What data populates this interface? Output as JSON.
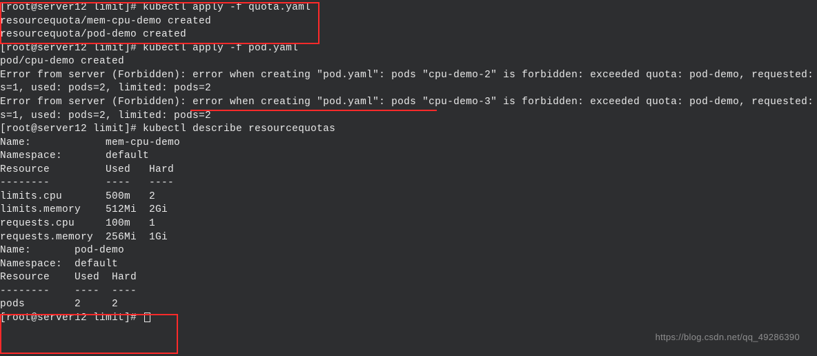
{
  "terminal": {
    "lines": {
      "l1": "[root@server12 limit]# kubectl apply -f quota.yaml",
      "l2": "resourcequota/mem-cpu-demo created",
      "l3": "resourcequota/pod-demo created",
      "l4": "[root@server12 limit]# kubectl apply -f pod.yaml",
      "l5": "pod/cpu-demo created",
      "l6": "Error from server (Forbidden): error when creating \"pod.yaml\": pods \"cpu-demo-2\" is forbidden: exceeded quota: pod-demo, requested:",
      "l7": "s=1, used: pods=2, limited: pods=2",
      "l8": "Error from server (Forbidden): error when creating \"pod.yaml\": pods \"cpu-demo-3\" is forbidden: exceeded quota: pod-demo, requested:",
      "l9": "s=1, used: pods=2, limited: pods=2",
      "l10": "[root@server12 limit]# kubectl describe resourcequotas",
      "l11": "Name:            mem-cpu-demo",
      "l12": "Namespace:       default",
      "l13": "Resource         Used   Hard",
      "l14": "--------         ----   ----",
      "l15": "limits.cpu       500m   2",
      "l16": "limits.memory    512Mi  2Gi",
      "l17": "requests.cpu     100m   1",
      "l18": "requests.memory  256Mi  1Gi",
      "l19": "",
      "l20": "",
      "l21": "Name:       pod-demo",
      "l22": "Namespace:  default",
      "l23": "Resource    Used  Hard",
      "l24": "--------    ----  ----",
      "l25": "pods        2     2",
      "l26": "[root@server12 limit]# "
    }
  },
  "resourcequota1": {
    "name": "mem-cpu-demo",
    "namespace": "default",
    "rows": [
      {
        "resource": "limits.cpu",
        "used": "500m",
        "hard": "2"
      },
      {
        "resource": "limits.memory",
        "used": "512Mi",
        "hard": "2Gi"
      },
      {
        "resource": "requests.cpu",
        "used": "100m",
        "hard": "1"
      },
      {
        "resource": "requests.memory",
        "used": "256Mi",
        "hard": "1Gi"
      }
    ]
  },
  "resourcequota2": {
    "name": "pod-demo",
    "namespace": "default",
    "rows": [
      {
        "resource": "pods",
        "used": "2",
        "hard": "2"
      }
    ]
  },
  "watermark": "https://blog.csdn.net/qq_49286390"
}
